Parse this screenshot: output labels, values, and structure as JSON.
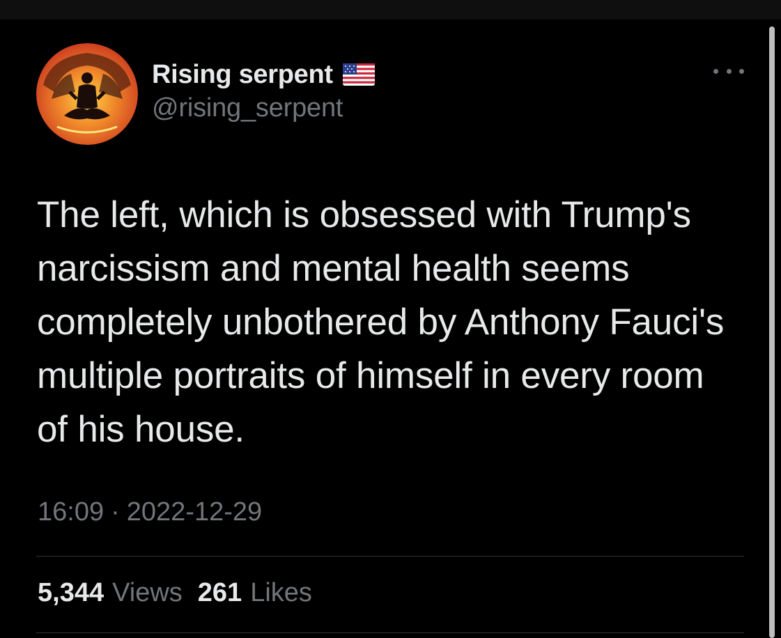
{
  "colors": {
    "background": "#000000",
    "text_primary": "#e7e9ea",
    "text_secondary": "#71767b",
    "divider": "#2f3336"
  },
  "author": {
    "display_name": "Rising serpent",
    "flag_icon": "us-flag-icon",
    "handle": "@rising_serpent",
    "avatar_icon": "meditating-figure-avatar"
  },
  "more_icon": "more-horizontal-icon",
  "tweet": {
    "text": "The left, which is obsessed with Trump's narcissism and mental health seems completely unbothered by Anthony Fauci's multiple portraits of himself in every room of his house.",
    "time": "16:09",
    "separator": "·",
    "date": "2022-12-29"
  },
  "stats": {
    "views_count": "5,344",
    "views_label": "Views",
    "likes_count": "261",
    "likes_label": "Likes"
  }
}
